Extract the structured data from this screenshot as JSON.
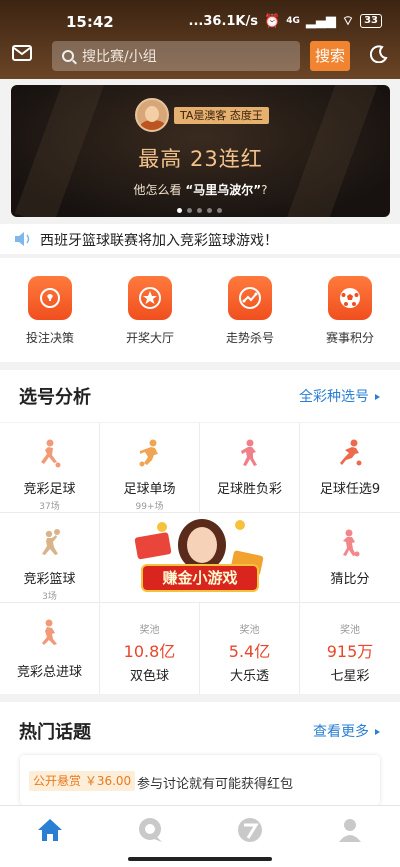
{
  "status": {
    "time": "15:42",
    "net_speed": "...36.1K/s",
    "network": "4G",
    "battery": "33"
  },
  "header": {
    "search_placeholder": "搜比赛/小组",
    "search_button": "搜索"
  },
  "banner": {
    "tag": "TA是澳客 态度王",
    "headline": "最高 23连红",
    "sub_prefix": "他怎么看",
    "sub_highlight": "“马里乌波尔”",
    "sub_suffix": "?",
    "pages": 5,
    "active_page": 1
  },
  "notice": {
    "text": "西班牙篮球联赛将加入竞彩篮球游戏！"
  },
  "quick": [
    {
      "label": "投注决策",
      "icon": "bulb-icon"
    },
    {
      "label": "开奖大厅",
      "icon": "star-icon"
    },
    {
      "label": "走势杀号",
      "icon": "trend-icon"
    },
    {
      "label": "赛事积分",
      "icon": "soccer-ball-icon"
    }
  ],
  "pick": {
    "title": "选号分析",
    "more": "全彩种选号"
  },
  "grid": {
    "r1": [
      {
        "name": "竞彩足球",
        "sub": "37场"
      },
      {
        "name": "足球单场",
        "sub": "99+场"
      },
      {
        "name": "足球胜负彩",
        "sub": ""
      },
      {
        "name": "足球任选9",
        "sub": ""
      }
    ],
    "r2": [
      {
        "name": "竞彩篮球",
        "sub": "3场"
      },
      {
        "name": "猜比分",
        "sub": ""
      }
    ],
    "game_label": "赚金小游戏",
    "r3_first": "竞彩总进球",
    "pools": [
      {
        "pool_label": "奖池",
        "amount": "10.8亿",
        "name": "双色球"
      },
      {
        "pool_label": "奖池",
        "amount": "5.4亿",
        "name": "大乐透"
      },
      {
        "pool_label": "奖池",
        "amount": "915万",
        "name": "七星彩"
      }
    ]
  },
  "topics": {
    "title": "热门话题",
    "more": "查看更多",
    "reward": "公开悬赏 ￥36.00",
    "desc": "参与讨论就有可能获得红包"
  },
  "colors": {
    "brand_orange": "#f08430",
    "header_brown": "#5a3a20",
    "link_blue": "#2a7fd4",
    "amount_red": "#e8472b"
  }
}
